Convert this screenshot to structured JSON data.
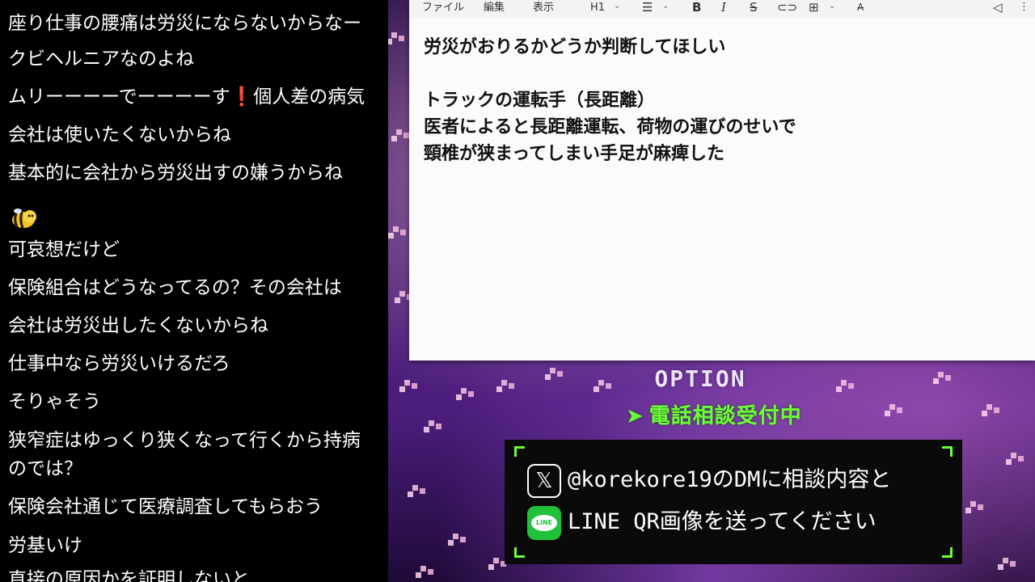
{
  "chat": {
    "messages": [
      "座り仕事の腰痛は労災にならないからなー",
      "クビヘルニアなのよね",
      "ムリーーーーでーーーーす",
      "個人差の病気",
      "会社は使いたくないからね",
      "基本的に会社から労災出すの嫌うからね",
      "可哀想だけど",
      "保険組合はどうなってるの？その会社は",
      "会社は労災出したくないからね",
      "仕事中なら労災いけるだろ",
      "そりゃそう",
      "狭窄症はゆっくり狭くなって行くから持病",
      "のでは？",
      "保険会社通じて医療調査してもらおう",
      "労基いけ",
      "直接の原因かを証明しないと"
    ],
    "exclamation": "❗",
    "emote_icon": "bee-emote-icon"
  },
  "editor": {
    "menu": {
      "file": "ファイル",
      "edit": "編集",
      "view": "表示",
      "heading": "H1"
    },
    "icons": [
      "list-icon",
      "bold-icon",
      "italic-icon",
      "strikethrough-icon",
      "link-icon",
      "table-icon",
      "clear-format-icon",
      "share-icon"
    ],
    "document": {
      "line1": "労災がおりるかどうか判断してほしい",
      "line2": "",
      "line3": "トラックの運転手（長距離）",
      "line4": "医者によると長距離運転、荷物の運びのせいで",
      "line5": "頸椎が狭まってしまい手足が麻痺した"
    }
  },
  "overlay": {
    "title": "OPTION",
    "subtitle": "電話相談受付中",
    "dm_line": "@korekore19のDMに相談内容と",
    "line_text": "LINE QR画像を送ってください",
    "x_logo": "𝕏",
    "line_logo": "LINE",
    "accent_color": "#6cff3a"
  }
}
